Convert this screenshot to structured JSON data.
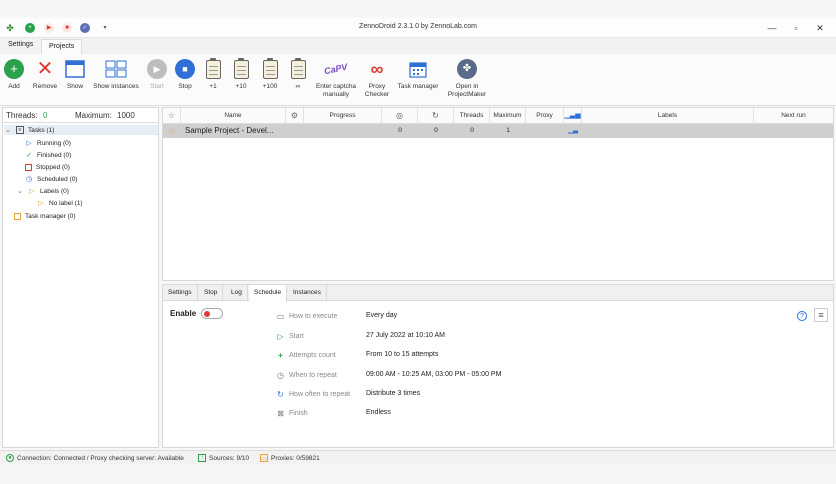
{
  "window": {
    "title": "ZennoDroid 2.3.1.0 by ZennoLab.com"
  },
  "menu_tabs": [
    "Settings",
    "Projects"
  ],
  "toolbar": {
    "add": "Add",
    "remove": "Remove",
    "show": "Show",
    "show_instances": "Show instances",
    "start": "Start",
    "stop": "Stop",
    "plus1": "+1",
    "plus10": "+10",
    "plus100": "+100",
    "infinite": "∞",
    "enter_captcha": "Enter captcha manually",
    "proxy_checker": "Proxy Checker",
    "task_manager": "Task manager",
    "open_projectmaker": "Open in ProjectMaker",
    "captcha_text": "CaPV"
  },
  "left_panel": {
    "threads_label": "Threads:",
    "threads_value": "0",
    "maximum_label": "Maximum:",
    "maximum_value": "1000",
    "tree": {
      "tasks": "Tasks (1)",
      "running": "Running (0)",
      "finished": "Finished (0)",
      "stopped": "Stopped (0)",
      "scheduled": "Scheduled (0)",
      "labels": "Labels (0)",
      "no_label": "No label (1)",
      "task_manager": "Task manager (0)"
    }
  },
  "grid": {
    "headers": {
      "name": "Name",
      "progress": "Progress",
      "threads": "Threads",
      "maximum": "Maximum",
      "proxy": "Proxy",
      "labels": "Labels",
      "next_run": "Next run"
    },
    "rows": [
      {
        "name": "Sample Project - Devel...",
        "success": "0",
        "fail": "0",
        "threads": "0",
        "maximum": "1"
      }
    ]
  },
  "bottom_tabs": [
    "Settings",
    "Stop",
    "Log",
    "Schedule",
    "Instances"
  ],
  "schedule": {
    "enable_label": "Enable",
    "rows": [
      {
        "label": "How to execute",
        "value": "Every day"
      },
      {
        "label": "Start",
        "value": "27 July 2022 at 10:10 AM"
      },
      {
        "label": "Attempts count",
        "value": "From 10 to 15 attempts"
      },
      {
        "label": "When to repeat",
        "value": "09:00 AM - 10:25 AM, 03:00 PM - 05:00 PM"
      },
      {
        "label": "How often to repeat",
        "value": "Distribute 3 times"
      },
      {
        "label": "Finish",
        "value": "Endless"
      }
    ]
  },
  "status_bar": {
    "connection": "Connection: Connected / Proxy checking server: Available",
    "sources": "Sources: 9/10",
    "proxies": "Proxies: 0/59821"
  },
  "colors": {
    "accent_blue": "#2f6fd6",
    "green": "#2aa14b",
    "red": "#e03c31",
    "row_selected": "#cfcfcf"
  }
}
